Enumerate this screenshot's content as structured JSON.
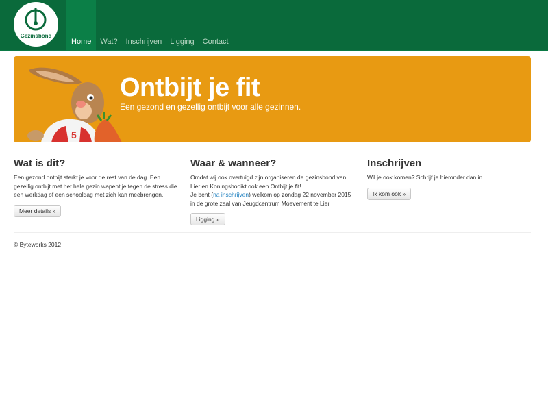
{
  "brand": {
    "name": "Gezinsbond",
    "color": "#0a6a3b"
  },
  "nav": {
    "items": [
      {
        "label": "Home",
        "active": true
      },
      {
        "label": "Wat?",
        "active": false
      },
      {
        "label": "Inschrijven",
        "active": false
      },
      {
        "label": "Ligging",
        "active": false
      },
      {
        "label": "Contact",
        "active": false
      }
    ]
  },
  "hero": {
    "title": "Ontbijt je fit",
    "subtitle": "Een gezond en gezellig ontbijt voor alle gezinnen.",
    "background": "#e89a12",
    "image": "rabbit-mascot"
  },
  "columns": {
    "what": {
      "heading": "Wat is dit?",
      "text": "Een gezond ontbijt sterkt je voor de rest van de dag. Een gezellig ontbijt met het hele gezin wapent je tegen de stress die een werkdag of een schooldag met zich kan meebrengen.",
      "button": "Meer details »"
    },
    "where": {
      "heading": "Waar & wanneer?",
      "text1": "Omdat wij ook overtuigd zijn organiseren de gezinsbond van Lier en Koningshooikt ook een Ontbijt je fit!",
      "text2_pre": "Je bent (",
      "text2_link": "na inschrijven",
      "text2_post": ") welkom op zondag 22 november 2015 in de grote zaal van Jeugdcentrum Moevement te Lier",
      "button": "Ligging »"
    },
    "signup": {
      "heading": "Inschrijven",
      "text": "Wil je ook komen? Schrijf je hieronder dan in.",
      "button": "Ik kom ook »"
    }
  },
  "footer": {
    "text": "© Byteworks 2012"
  }
}
